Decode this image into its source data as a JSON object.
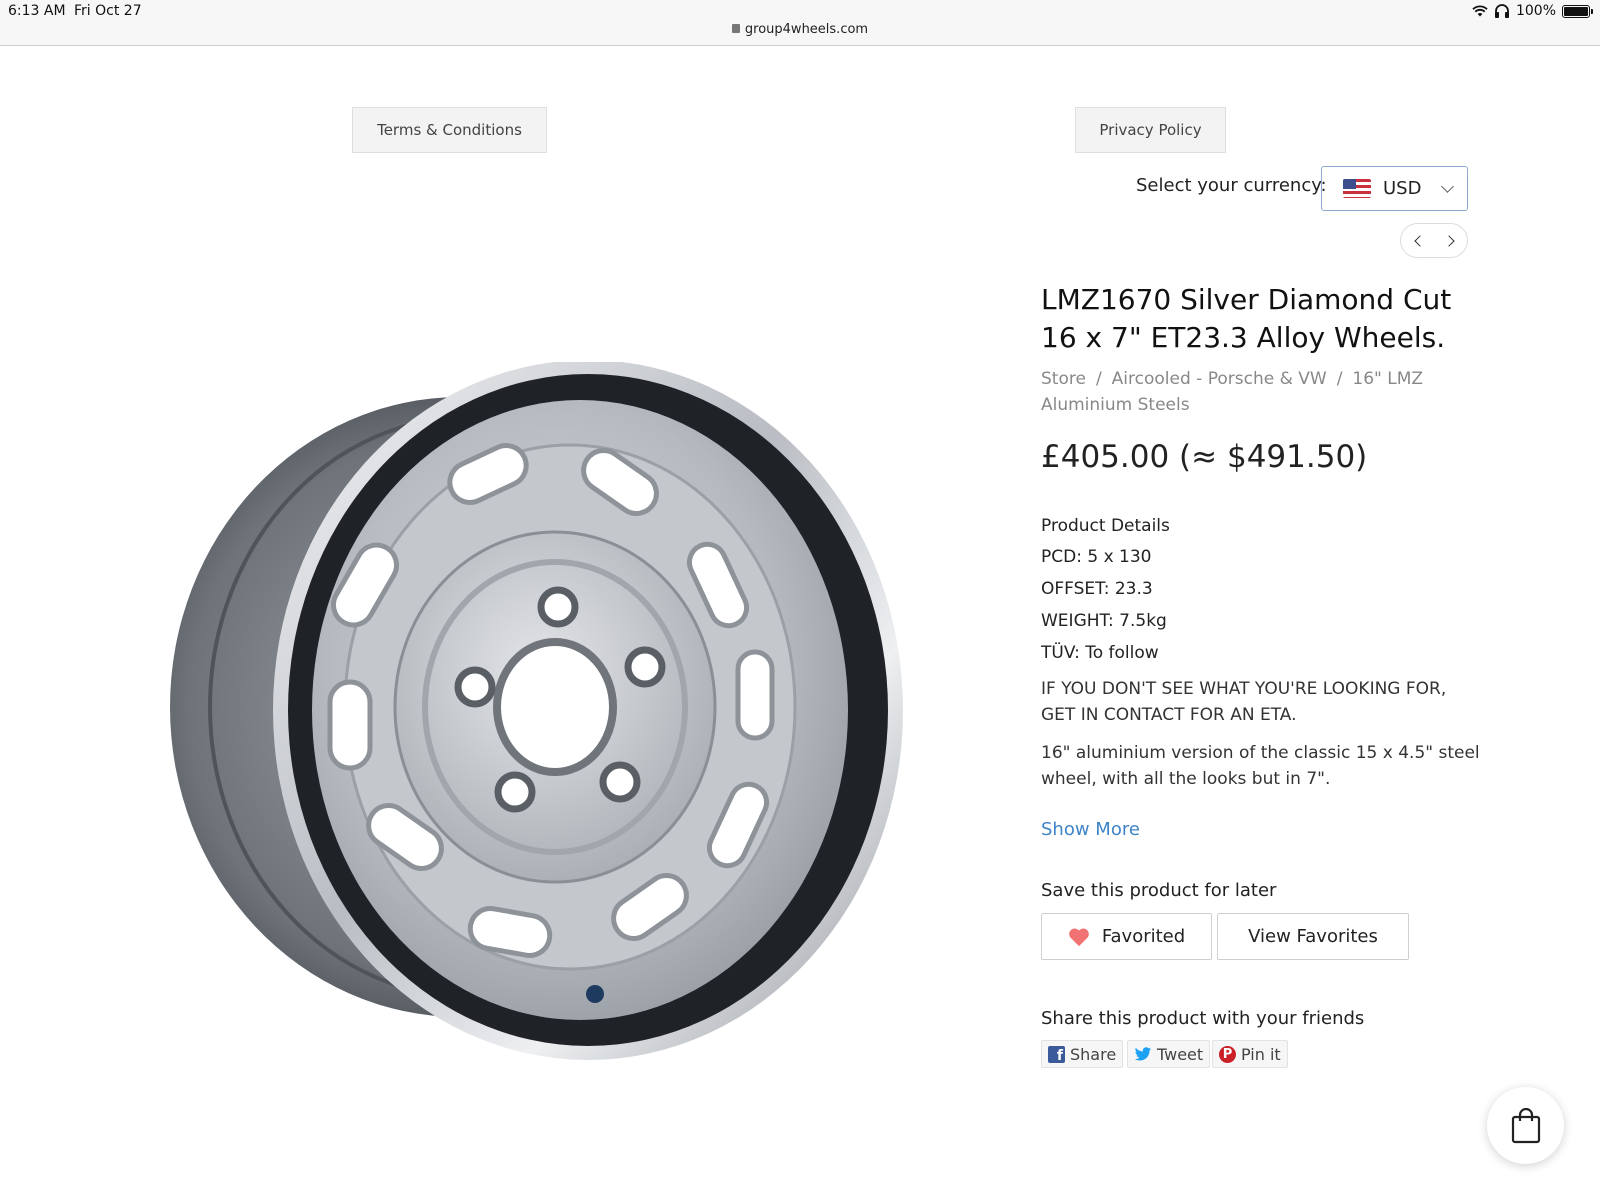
{
  "status_bar": {
    "time": "6:13 AM",
    "date": "Fri Oct 27",
    "battery": "100%"
  },
  "url_bar": {
    "url": "group4wheels.com"
  },
  "links": {
    "terms": "Terms & Conditions",
    "privacy": "Privacy Policy"
  },
  "currency": {
    "label": "Select your currency:",
    "selected": "USD",
    "flag_icon": "us-flag-icon"
  },
  "product": {
    "title": "LMZ1670 Silver Diamond Cut 16 x 7\" ET23.3 Alloy Wheels.",
    "breadcrumb": [
      "Store",
      "Aircooled - Porsche & VW",
      "16\" LMZ Aluminium Steels"
    ],
    "price": "£405.00 (≈ $491.50)",
    "details_title": "Product Details",
    "specs": [
      "PCD: 5 x 130",
      "OFFSET: 23.3",
      "WEIGHT: 7.5kg",
      "TÜV: To follow"
    ],
    "notice": "IF YOU DON'T SEE WHAT YOU'RE LOOKING FOR, GET IN CONTACT FOR AN ETA.",
    "description": "16\" aluminium version of the classic 15 x 4.5\" steel wheel, with all the looks but in 7\".",
    "show_more": "Show More"
  },
  "favorites": {
    "label": "Save this product for later",
    "favorited": "Favorited",
    "view": "View Favorites",
    "heart_color": "#f07272"
  },
  "share": {
    "label": "Share this product with your friends",
    "facebook": "Share",
    "twitter": "Tweet",
    "pinterest": "Pin it"
  },
  "colors": {
    "link": "#3e84c6",
    "facebook": "#3b5a9a",
    "twitter": "#1da1f2",
    "pinterest": "#cb2027"
  }
}
